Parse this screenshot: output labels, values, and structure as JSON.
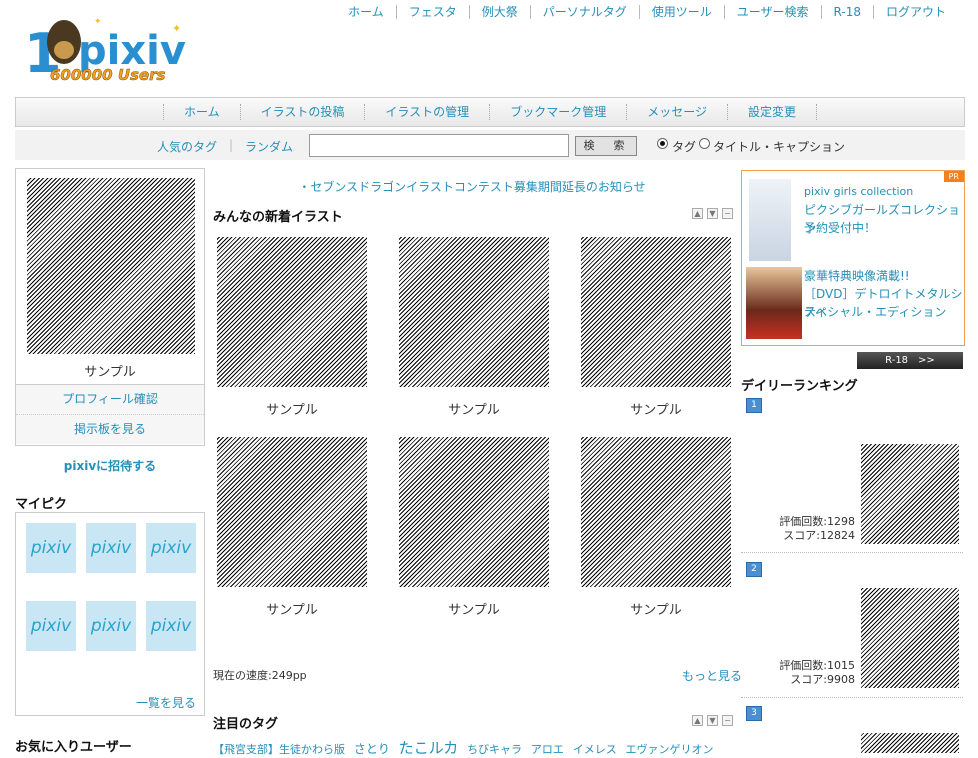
{
  "logo": {
    "number": "1",
    "wordmark": "pixiv",
    "users_text": "600000 Users"
  },
  "top_nav": [
    "ホーム",
    "フェスタ",
    "例大祭",
    "パーソナルタグ",
    "使用ツール",
    "ユーザー検索",
    "R-18",
    "ログアウト"
  ],
  "main_nav": [
    "ホーム",
    "イラストの投稿",
    "イラストの管理",
    "ブックマーク管理",
    "メッセージ",
    "設定変更"
  ],
  "search": {
    "link_popular": "人気のタグ",
    "link_random": "ランダム",
    "value": "",
    "button": "検　索",
    "radio_tag": "タグ",
    "radio_title": "タイトル・キャプション",
    "selected": "tag"
  },
  "profile": {
    "caption": "サンプル",
    "link1": "プロフィール確認",
    "link2": "掲示板を見る"
  },
  "invite": "pixivに招待する",
  "mypick": {
    "title": "マイピク",
    "thumbs": [
      "pixiv",
      "pixiv",
      "pixiv",
      "pixiv",
      "pixiv",
      "pixiv"
    ],
    "more": "一覧を見る"
  },
  "favorites_title": "お気に入りユーザー",
  "notice": "・セブンスドラゴンイラストコンテスト募集期間延長のお知らせ",
  "new_illust": {
    "title": "みんなの新着イラスト",
    "captions": [
      "サンプル",
      "サンプル",
      "サンプル",
      "サンプル",
      "サンプル",
      "サンプル"
    ],
    "speed": "現在の速度:249pp",
    "more": "もっと見る"
  },
  "featured_tags": {
    "title": "注目のタグ",
    "tags": [
      "【飛宮支部】生徒かわら版",
      "さとり",
      "たこルカ",
      "ちびキャラ",
      "アロエ",
      "イメレス",
      "エヴァンゲリオン"
    ]
  },
  "pr": {
    "badge": "PR",
    "ad1": [
      "pixiv girls collection",
      "ピクシブガールズコレクション",
      "予約受付中！"
    ],
    "ad2": [
      "豪華特典映像満載!!",
      "［DVD］デトロイトメタルシティ",
      "スペシャル・エディション"
    ]
  },
  "r18_button": "R-18　>>",
  "ranking": {
    "title": "デイリーランキング",
    "items": [
      {
        "rank": "1",
        "votes": "評価回数:1298",
        "score": "スコア:12824"
      },
      {
        "rank": "2",
        "votes": "評価回数:1015",
        "score": "スコア:9908"
      },
      {
        "rank": "3",
        "votes": "",
        "score": ""
      }
    ]
  }
}
